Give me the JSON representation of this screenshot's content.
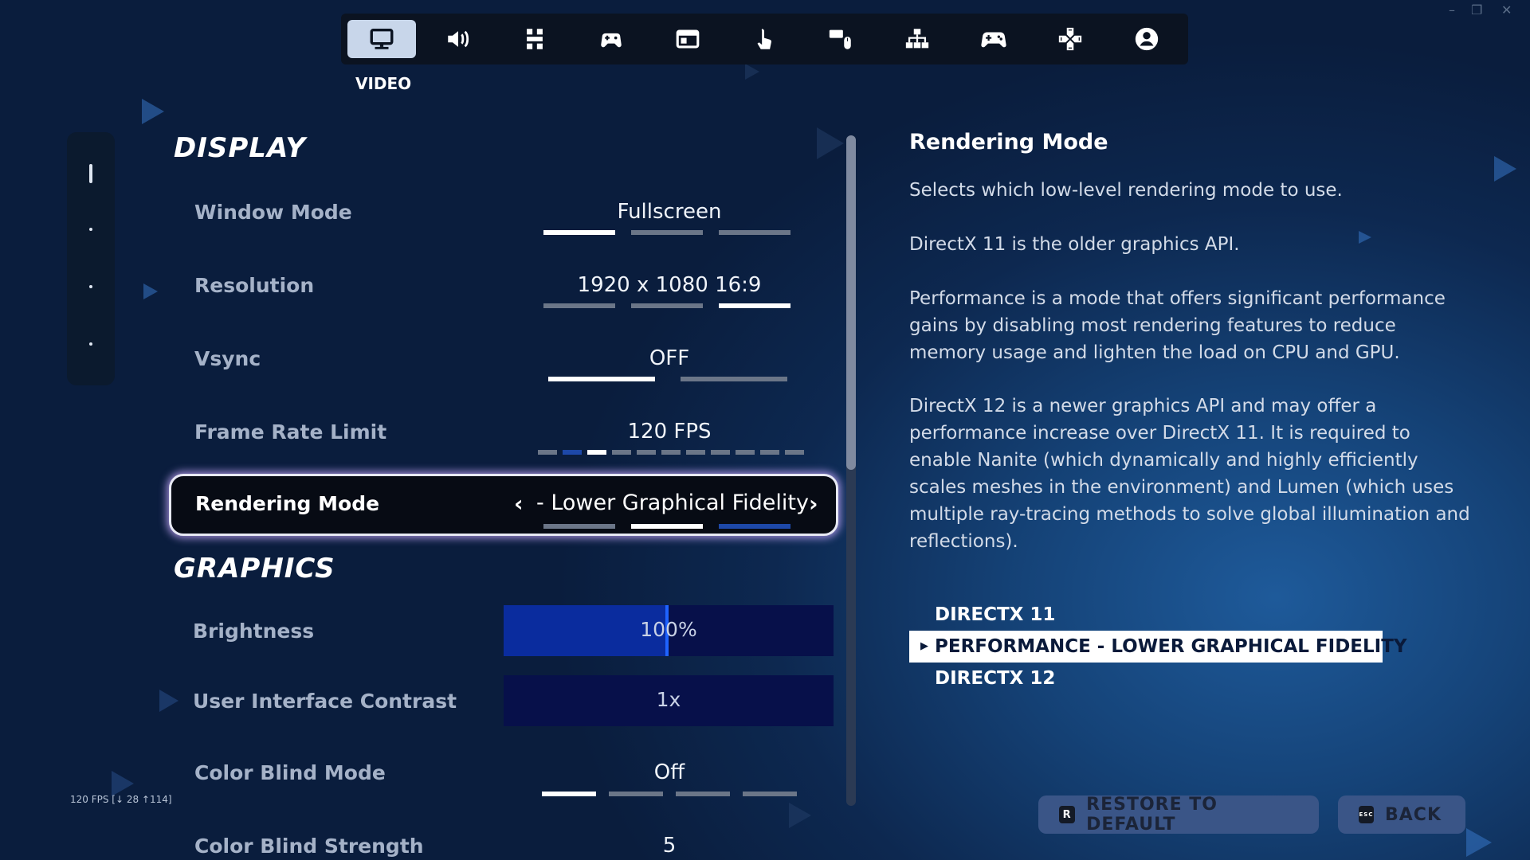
{
  "window_controls": {
    "minimize": "–",
    "restore": "❐",
    "close": "✕"
  },
  "tabs": [
    {
      "icon": "monitor-icon",
      "active": true
    },
    {
      "icon": "speaker-icon",
      "active": false
    },
    {
      "icon": "accessibility-icon",
      "active": false
    },
    {
      "icon": "controller-hand-icon",
      "active": false
    },
    {
      "icon": "hud-icon",
      "active": false
    },
    {
      "icon": "touch-icon",
      "active": false
    },
    {
      "icon": "keyboard-mouse-icon",
      "active": false
    },
    {
      "icon": "network-icon",
      "active": false
    },
    {
      "icon": "gamepad-icon",
      "active": false
    },
    {
      "icon": "dpad-icon",
      "active": false
    },
    {
      "icon": "account-icon",
      "active": false
    }
  ],
  "active_tab_caption": "VIDEO",
  "sections": {
    "display": "DISPLAY",
    "graphics": "GRAPHICS"
  },
  "settings": {
    "window_mode": {
      "label": "Window Mode",
      "value": "Fullscreen",
      "selected_index": 0,
      "option_count": 3
    },
    "resolution": {
      "label": "Resolution",
      "value": "1920 x 1080 16:9",
      "selected_index": 2,
      "option_count": 3
    },
    "vsync": {
      "label": "Vsync",
      "value": "OFF",
      "selected_index": 0,
      "option_count": 2
    },
    "frame_rate_limit": {
      "label": "Frame Rate Limit",
      "value": "120 FPS",
      "selected_index": 2,
      "option_count": 11
    },
    "rendering_mode": {
      "label": "Rendering Mode",
      "value": "- Lower Graphical Fidelity",
      "selected_index": 1,
      "option_count": 3
    },
    "brightness": {
      "label": "Brightness",
      "value": "100%",
      "fill": 0.5
    },
    "ui_contrast": {
      "label": "User Interface Contrast",
      "value": "1x",
      "fill": 0
    },
    "color_blind_mode": {
      "label": "Color Blind Mode",
      "value": "Off",
      "selected_index": 0,
      "option_count": 4
    },
    "color_blind_strength": {
      "label": "Color Blind Strength",
      "value": "5"
    }
  },
  "fps_counter": "120 FPS [↓ 28 ↑114]",
  "description": {
    "title": "Rendering Mode",
    "paragraphs": [
      "Selects which low-level rendering mode to use.",
      "DirectX 11 is the older graphics API.",
      "Performance is a mode that offers significant performance gains by disabling most rendering features to reduce memory usage and lighten the load on CPU and GPU.",
      "DirectX 12 is a newer graphics API and may offer a performance increase over DirectX 11. It is required to enable Nanite (which dynamically and highly efficiently scales meshes in the environment) and Lumen (which uses multiple ray-tracing methods to solve global illumination and reflections)."
    ],
    "options": [
      "DIRECTX 11",
      "PERFORMANCE - LOWER GRAPHICAL FIDELITY",
      "DIRECTX 12"
    ],
    "selected_option": 1
  },
  "footer": {
    "restore_key": "R",
    "restore_label": "RESTORE TO DEFAULT",
    "back_key": "ESC",
    "back_label": "BACK"
  },
  "colors": {
    "accent_blue": "#1d48a8",
    "selection_glow": "#c8aaff",
    "panel_bg": "#0b1321"
  }
}
